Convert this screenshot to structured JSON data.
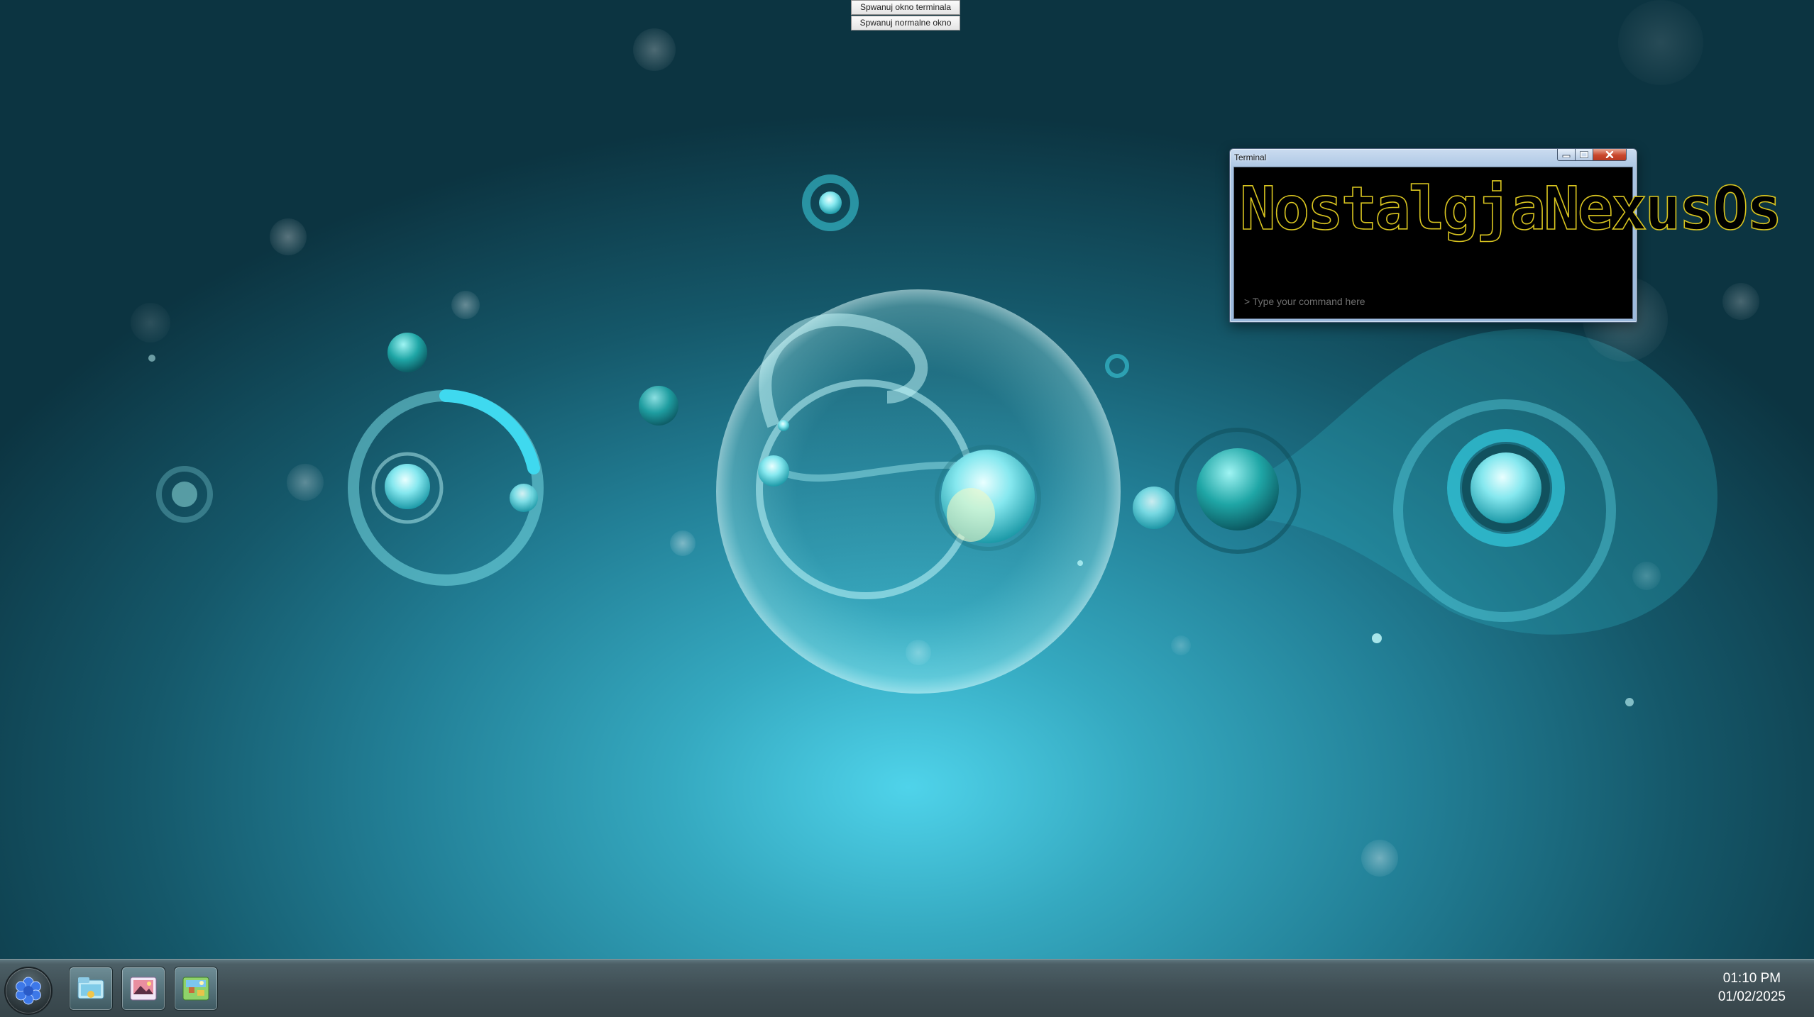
{
  "top_buttons": {
    "spawn_terminal": "Spwanuj okno terminala",
    "spawn_normal": "Spwanuj normalne okno"
  },
  "terminal": {
    "title": "Terminal",
    "banner": "NostalgjaNexusOs",
    "banner_color": "#d8c420",
    "input_placeholder": "> Type your command here",
    "controls": [
      "minimize-icon",
      "maximize-icon",
      "close-icon"
    ]
  },
  "taskbar": {
    "start_icon": "flower-logo-icon",
    "apps": [
      {
        "icon": "file-explorer-icon"
      },
      {
        "icon": "photo-viewer-icon"
      },
      {
        "icon": "game-icon"
      }
    ],
    "clock": {
      "time": "01:10 PM",
      "date": "01/02/2025"
    }
  },
  "colors": {
    "desktop_accent": "#3cc8e0",
    "taskbar": "#3e4d53",
    "close_button": "#c9472c"
  }
}
